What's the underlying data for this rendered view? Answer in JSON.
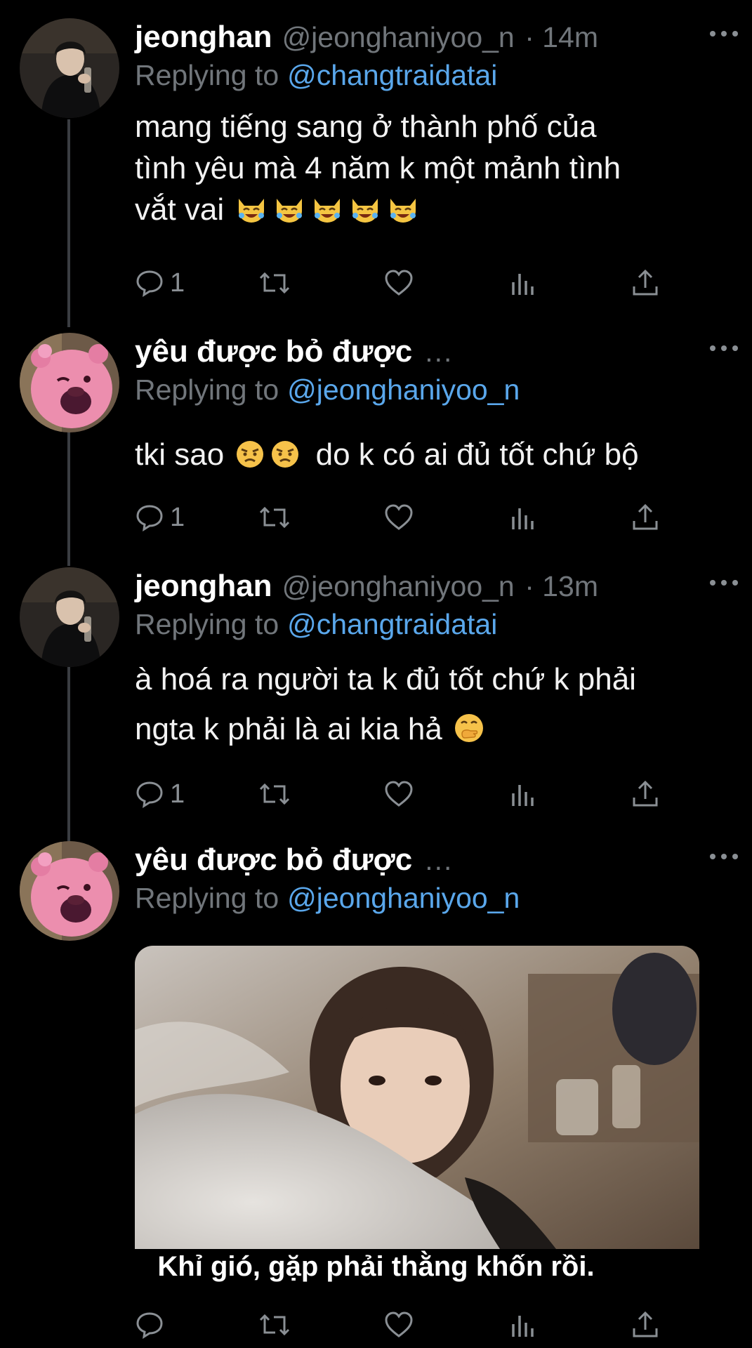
{
  "tweets": [
    {
      "name": "jeonghan",
      "handle": "@jeonghaniyoo_n",
      "time": "· 14m",
      "replying_prefix": "Replying to",
      "replying_to": "@changtraidatai",
      "text_lines": [
        "mang tiếng sang ở thành phố của",
        "tình yêu mà 4 năm k một mảnh tình",
        "vắt vai"
      ],
      "emojis": [
        "laughing-cat-emoji",
        "laughing-cat-emoji",
        "laughing-cat-emoji",
        "laughing-cat-emoji",
        "laughing-cat-emoji"
      ],
      "reply_count": "1"
    },
    {
      "name": "yêu được bỏ được",
      "ellipsis": "...",
      "replying_prefix": "Replying to",
      "replying_to": "@jeonghaniyoo_n",
      "text_before": "tki sao",
      "text_after": "do k có ai đủ tốt chứ bộ",
      "emojis": [
        "angry-face-emoji",
        "angry-face-emoji"
      ],
      "reply_count": "1"
    },
    {
      "name": "jeonghan",
      "handle": "@jeonghaniyoo_n",
      "time": "· 13m",
      "replying_prefix": "Replying to",
      "replying_to": "@changtraidatai",
      "text_lines": [
        "à hoá ra người ta k đủ tốt chứ k phải",
        "ngta k phải là ai kia hả"
      ],
      "emojis": [
        "hand-over-mouth-emoji"
      ],
      "reply_count": "1"
    },
    {
      "name": "yêu được bỏ được",
      "ellipsis": "...",
      "replying_prefix": "Replying to",
      "replying_to": "@jeonghaniyoo_n",
      "media_caption": "Khỉ gió, gặp phải thằng khốn rồi.",
      "reply_count": ""
    }
  ],
  "icons": [
    "reply-icon",
    "retweet-icon",
    "like-icon",
    "analytics-icon",
    "share-icon",
    "more-options-icon"
  ],
  "colors": {
    "background": "#000000",
    "mention": "#5aa7eb",
    "secondary": "#71767b",
    "thread_line": "#3a3d42"
  }
}
